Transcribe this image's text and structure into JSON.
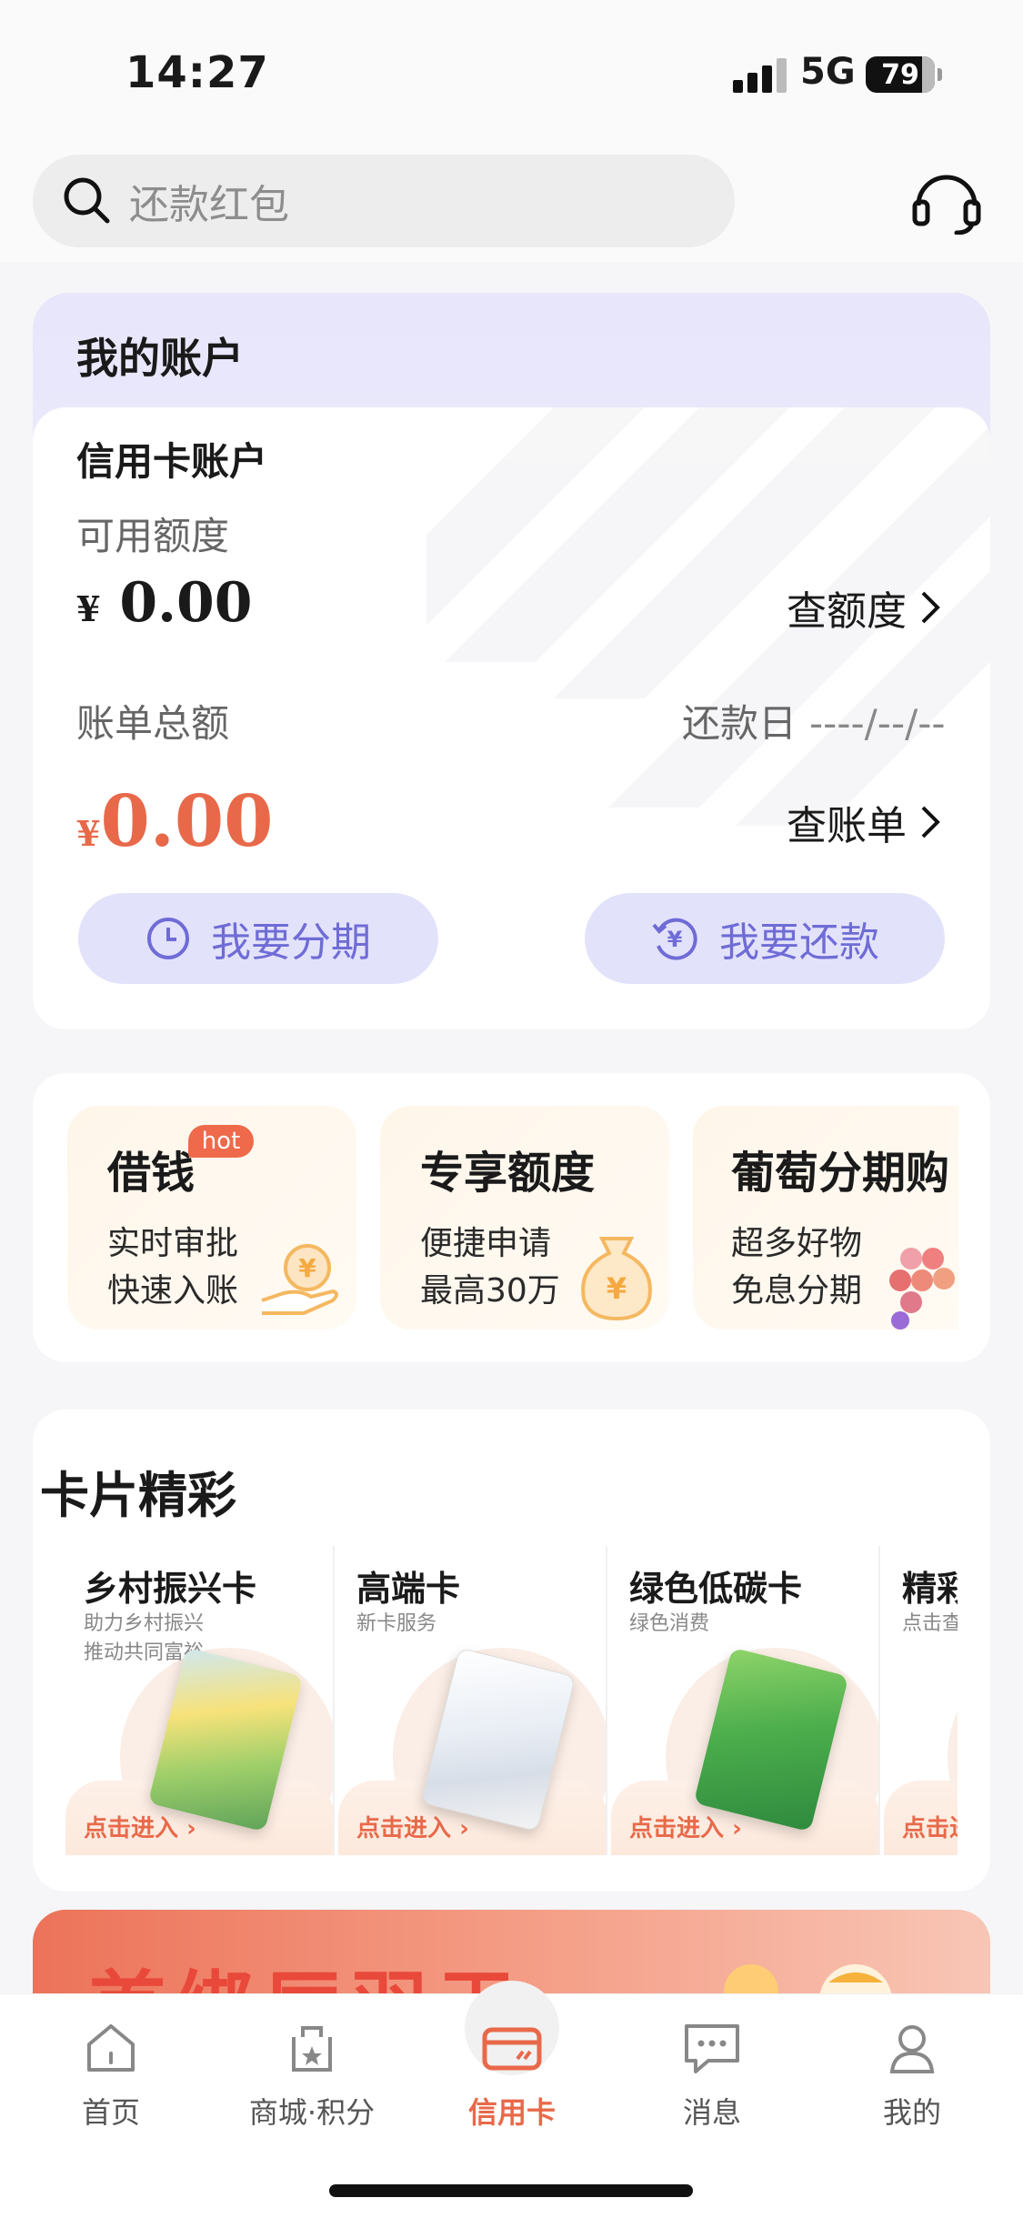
{
  "status_bar": {
    "time": "14:27",
    "network": "5G",
    "battery": "79"
  },
  "search": {
    "placeholder": "还款红包"
  },
  "account": {
    "section_title": "我的账户",
    "card_title": "信用卡账户",
    "available_label": "可用额度",
    "currency": "¥",
    "available_value": "0.00",
    "check_limit": "查额度",
    "bill_label": "账单总额",
    "due_label": "还款日",
    "due_value": "----/--/--",
    "bill_value": "0.00",
    "check_bill": "查账单",
    "installment_button": "我要分期",
    "repay_button": "我要还款"
  },
  "loans": [
    {
      "title": "借钱",
      "badge": "hot",
      "line1": "实时审批",
      "line2": "快速入账"
    },
    {
      "title": "专享额度",
      "line1": "便捷申请",
      "line2": "最高30万"
    },
    {
      "title": "葡萄分期购",
      "line1": "超多好物",
      "line2": "免息分期"
    }
  ],
  "cards_section": {
    "title": "卡片精彩",
    "enter_label": "点击进入",
    "items": [
      {
        "name": "乡村振兴卡",
        "sub1": "助力乡村振兴",
        "sub2": "推动共同富裕"
      },
      {
        "name": "高端卡",
        "sub1": "新卡服务",
        "sub2": ""
      },
      {
        "name": "绿色低碳卡",
        "sub1": "绿色消费",
        "sub2": ""
      },
      {
        "name": "精彩",
        "sub1": "点击查",
        "sub2": ""
      }
    ]
  },
  "banner": {
    "text": "首绑厉羽玉"
  },
  "tabbar": [
    {
      "label": "首页",
      "icon": "home-icon"
    },
    {
      "label": "商城·积分",
      "icon": "shop-icon"
    },
    {
      "label": "信用卡",
      "icon": "credit-card-icon",
      "active": true
    },
    {
      "label": "消息",
      "icon": "message-icon"
    },
    {
      "label": "我的",
      "icon": "profile-icon"
    }
  ],
  "colors": {
    "accent": "#e8694a",
    "purple": "#6f6cd6",
    "purple_bg": "#e3e2fb"
  }
}
